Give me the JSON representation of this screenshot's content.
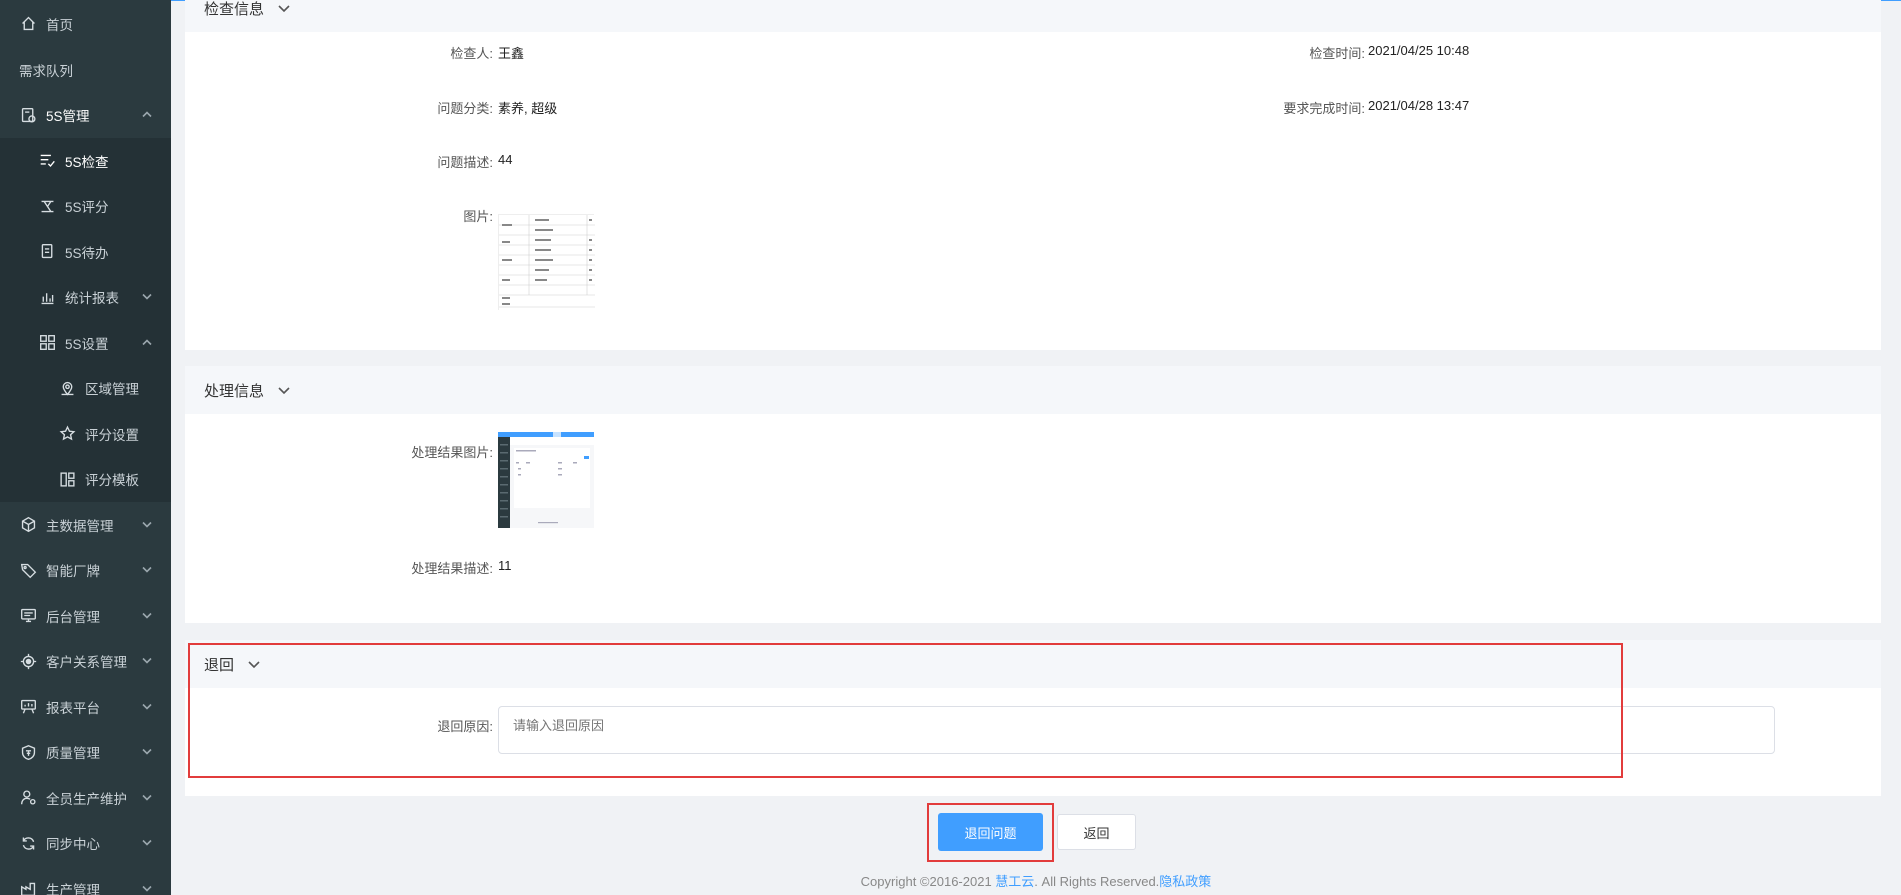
{
  "sidebar": {
    "home": "首页",
    "queue": "需求队列",
    "fiveS": "5S管理",
    "fiveS_check": "5S检查",
    "fiveS_score": "5S评分",
    "fiveS_todo": "5S待办",
    "stats": "统计报表",
    "fiveS_settings": "5S设置",
    "area": "区域管理",
    "score_settings": "评分设置",
    "score_template": "评分模板",
    "master_data": "主数据管理",
    "smart_sign": "智能厂牌",
    "backend": "后台管理",
    "crm": "客户关系管理",
    "report": "报表平台",
    "quality": "质量管理",
    "tpm": "全员生产维护",
    "sync": "同步中心",
    "production": "生产管理"
  },
  "inspection": {
    "title": "检查信息",
    "inspector_label": "检查人:",
    "inspector_value": "王鑫",
    "time_label": "检查时间:",
    "time_value": "2021/04/25 10:48",
    "category_label": "问题分类:",
    "category_value": "素养, 超级",
    "due_label": "要求完成时间:",
    "due_value": "2021/04/28 13:47",
    "desc_label": "问题描述:",
    "desc_value": "44",
    "image_label": "图片:"
  },
  "processing": {
    "title": "处理信息",
    "result_image_label": "处理结果图片:",
    "result_desc_label": "处理结果描述:",
    "result_desc_value": "11"
  },
  "reject": {
    "title": "退回",
    "reason_label": "退回原因:",
    "reason_placeholder": "请输入退回原因"
  },
  "actions": {
    "reject_issue": "退回问题",
    "back": "返回"
  },
  "footer": {
    "copyright": "Copyright ©2016-2021 ",
    "brand": "慧工云",
    "rights": ". All Rights Reserved.",
    "privacy": "隐私政策"
  },
  "colors": {
    "sidebar_bg": "#2b3a3f",
    "primary": "#409eff",
    "highlight": "#e23c3c"
  }
}
